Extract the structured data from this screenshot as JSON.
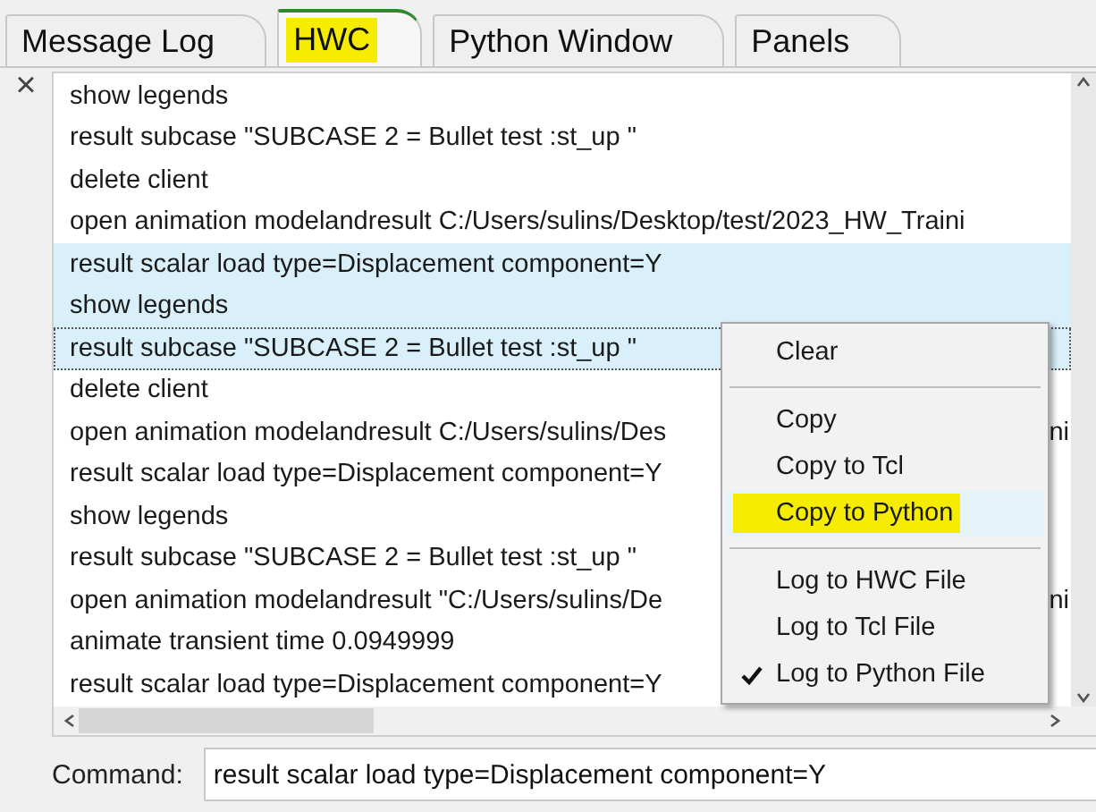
{
  "tabs": [
    {
      "label": "Message Log",
      "selected": false,
      "highlighted": false
    },
    {
      "label": "HWC",
      "selected": true,
      "highlighted": true
    },
    {
      "label": "Python Window",
      "selected": false,
      "highlighted": false
    },
    {
      "label": "Panels",
      "selected": false,
      "highlighted": false
    }
  ],
  "close": "×",
  "log": [
    {
      "text": "show legends",
      "selected": false,
      "focused": false
    },
    {
      "text": "result subcase \"SUBCASE 2 = Bullet test :st_up \"",
      "selected": false,
      "focused": false
    },
    {
      "text": "delete client",
      "selected": false,
      "focused": false
    },
    {
      "text": "open animation modelandresult C:/Users/sulins/Desktop/test/2023_HW_Traini",
      "selected": false,
      "focused": false
    },
    {
      "text": "result scalar load type=Displacement component=Y",
      "selected": true,
      "focused": false
    },
    {
      "text": "show legends",
      "selected": true,
      "focused": false
    },
    {
      "text": "result subcase \"SUBCASE 2 = Bullet test :st_up \"",
      "selected": true,
      "focused": true
    },
    {
      "text": "delete client",
      "selected": false,
      "focused": false
    },
    {
      "text": "open animation modelandresult C:/Users/sulins/Des",
      "tail": "ni",
      "selected": false,
      "focused": false
    },
    {
      "text": "result scalar load type=Displacement component=Y",
      "selected": false,
      "focused": false
    },
    {
      "text": "show legends",
      "selected": false,
      "focused": false
    },
    {
      "text": "result subcase \"SUBCASE 2 = Bullet test :st_up \"",
      "selected": false,
      "focused": false
    },
    {
      "text": "open animation modelandresult \"C:/Users/sulins/De",
      "tail": "ni",
      "selected": false,
      "focused": false
    },
    {
      "text": "animate transient time 0.0949999",
      "selected": false,
      "focused": false
    },
    {
      "text": "result scalar load type=Displacement component=Y",
      "selected": false,
      "focused": false
    }
  ],
  "context_menu": [
    {
      "kind": "item",
      "label": "Clear",
      "checked": false,
      "hovered": false,
      "highlighted": false
    },
    {
      "kind": "separator"
    },
    {
      "kind": "item",
      "label": "Copy",
      "checked": false,
      "hovered": false,
      "highlighted": false
    },
    {
      "kind": "item",
      "label": "Copy to Tcl",
      "checked": false,
      "hovered": false,
      "highlighted": false
    },
    {
      "kind": "item",
      "label": "Copy to Python",
      "checked": false,
      "hovered": true,
      "highlighted": true
    },
    {
      "kind": "separator"
    },
    {
      "kind": "item",
      "label": "Log to HWC File",
      "checked": false,
      "hovered": false,
      "highlighted": false
    },
    {
      "kind": "item",
      "label": "Log to Tcl File",
      "checked": false,
      "hovered": false,
      "highlighted": false
    },
    {
      "kind": "item",
      "label": "Log to Python File",
      "checked": true,
      "hovered": false,
      "highlighted": false
    }
  ],
  "command": {
    "label": "Command:",
    "value": "result scalar load type=Displacement component=Y"
  }
}
